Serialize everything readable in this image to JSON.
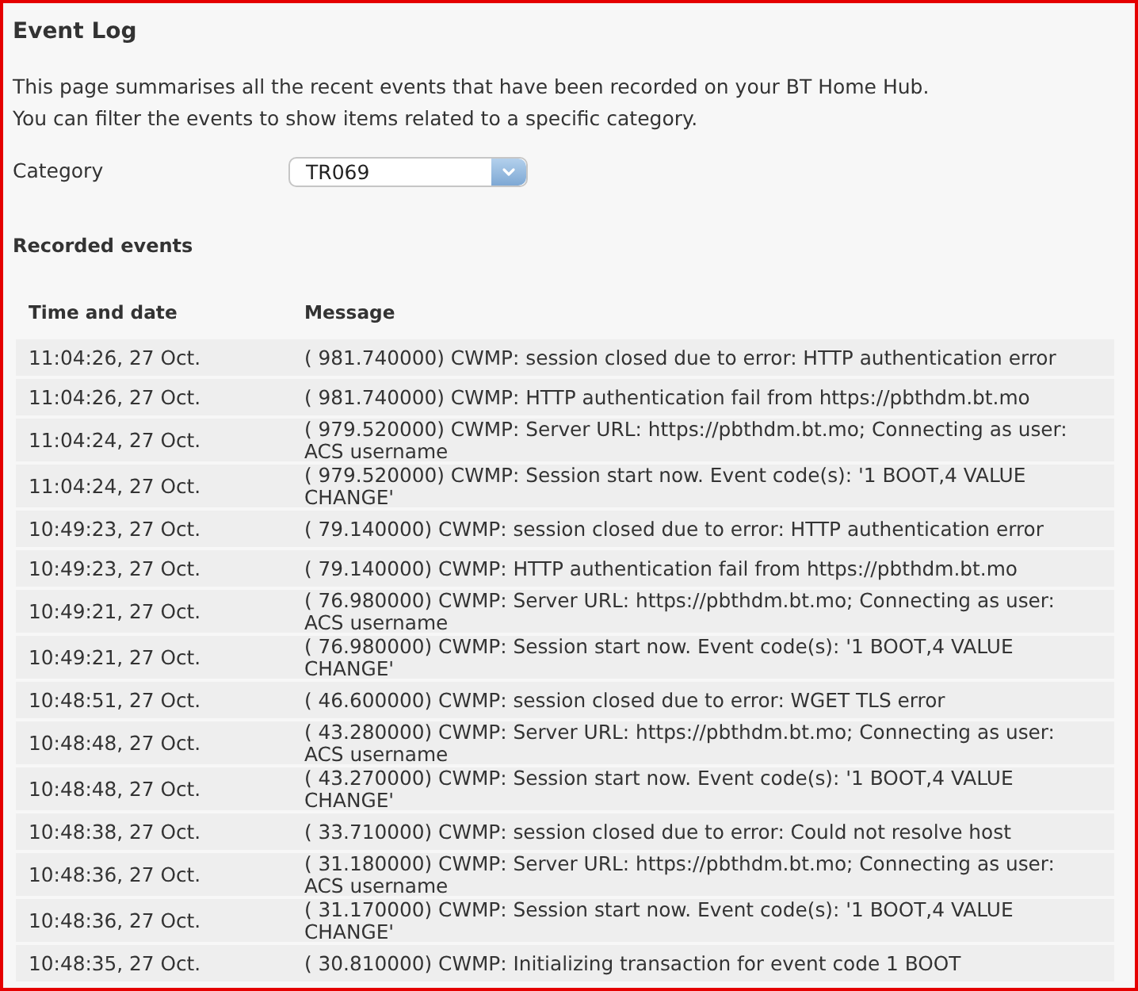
{
  "page": {
    "title": "Event Log",
    "description": [
      "This page summarises all the recent events that have been recorded on your BT Home Hub.",
      "You can filter the events to show items related to a specific category."
    ]
  },
  "filter": {
    "label": "Category",
    "value": "TR069"
  },
  "events": {
    "heading": "Recorded events",
    "columns": [
      "Time and date",
      "Message"
    ],
    "rows": [
      {
        "time": "11:04:26, 27 Oct.",
        "message": "( 981.740000) CWMP: session closed due to error: HTTP authentication error"
      },
      {
        "time": "11:04:26, 27 Oct.",
        "message": "( 981.740000) CWMP: HTTP authentication fail from https://pbthdm.bt.mo"
      },
      {
        "time": "11:04:24, 27 Oct.",
        "message": "( 979.520000) CWMP: Server URL: https://pbthdm.bt.mo; Connecting as user: ACS username"
      },
      {
        "time": "11:04:24, 27 Oct.",
        "message": "( 979.520000) CWMP: Session start now. Event code(s): '1 BOOT,4 VALUE CHANGE'"
      },
      {
        "time": "10:49:23, 27 Oct.",
        "message": "( 79.140000) CWMP: session closed due to error: HTTP authentication error"
      },
      {
        "time": "10:49:23, 27 Oct.",
        "message": "( 79.140000) CWMP: HTTP authentication fail from https://pbthdm.bt.mo"
      },
      {
        "time": "10:49:21, 27 Oct.",
        "message": "( 76.980000) CWMP: Server URL: https://pbthdm.bt.mo; Connecting as user: ACS username"
      },
      {
        "time": "10:49:21, 27 Oct.",
        "message": "( 76.980000) CWMP: Session start now. Event code(s): '1 BOOT,4 VALUE CHANGE'"
      },
      {
        "time": "10:48:51, 27 Oct.",
        "message": "( 46.600000) CWMP: session closed due to error: WGET TLS error"
      },
      {
        "time": "10:48:48, 27 Oct.",
        "message": "( 43.280000) CWMP: Server URL: https://pbthdm.bt.mo; Connecting as user: ACS username"
      },
      {
        "time": "10:48:48, 27 Oct.",
        "message": "( 43.270000) CWMP: Session start now. Event code(s): '1 BOOT,4 VALUE CHANGE'"
      },
      {
        "time": "10:48:38, 27 Oct.",
        "message": "( 33.710000) CWMP: session closed due to error: Could not resolve host"
      },
      {
        "time": "10:48:36, 27 Oct.",
        "message": "( 31.180000) CWMP: Server URL: https://pbthdm.bt.mo; Connecting as user: ACS username"
      },
      {
        "time": "10:48:36, 27 Oct.",
        "message": "( 31.170000) CWMP: Session start now. Event code(s): '1 BOOT,4 VALUE CHANGE'"
      },
      {
        "time": "10:48:35, 27 Oct.",
        "message": "( 30.810000) CWMP: Initializing transaction for event code 1 BOOT"
      }
    ]
  }
}
